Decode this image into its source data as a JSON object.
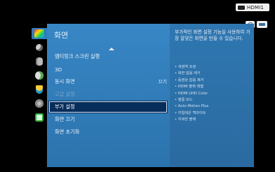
{
  "source": {
    "label": "HDMI1",
    "icon": "hdmi-input-icon"
  },
  "help_icons": [
    "help-icon",
    "remote-icon"
  ],
  "categories": [
    {
      "name": "picture-icon",
      "active": true
    },
    {
      "name": "sound-icon",
      "active": false
    },
    {
      "name": "broadcast-icon",
      "active": false
    },
    {
      "name": "network-icon",
      "active": false
    },
    {
      "name": "smart-hub-icon",
      "active": false
    },
    {
      "name": "system-icon",
      "active": false
    },
    {
      "name": "support-icon",
      "active": false
    }
  ],
  "menu": {
    "title": "화면",
    "items": [
      {
        "label": "엠티링크 스크린 실행",
        "value": "",
        "state": "normal"
      },
      {
        "label": "3D",
        "value": "",
        "state": "normal"
      },
      {
        "label": "동시 화면",
        "value": "끄기",
        "state": "normal"
      },
      {
        "label": "고급 설정",
        "value": "",
        "state": "disabled"
      },
      {
        "label": "부가 설정",
        "value": "",
        "state": "selected"
      },
      {
        "label": "화면 끄기",
        "value": "",
        "state": "normal"
      },
      {
        "label": "화면 초기화",
        "value": "",
        "state": "normal"
      }
    ]
  },
  "info": {
    "description": "부가적인 화면 설정 기능을 사용하여 가장 알맞은 화면을 만들 수 있습니다.",
    "features": [
      "색영역 조정",
      "화면 잡음 제거",
      "동영상 잡음 제거",
      "HDMI 블랙 레벨",
      "HDMI UHD Color",
      "필름 모드",
      "Auto Motion Plus",
      "키얼레온 백라이트",
      "자세한 블랙"
    ]
  },
  "colors": {
    "background": "#000000",
    "panel": "#2f7fbf",
    "selected_bg": "#072d5a",
    "text": "#eef5fb"
  }
}
